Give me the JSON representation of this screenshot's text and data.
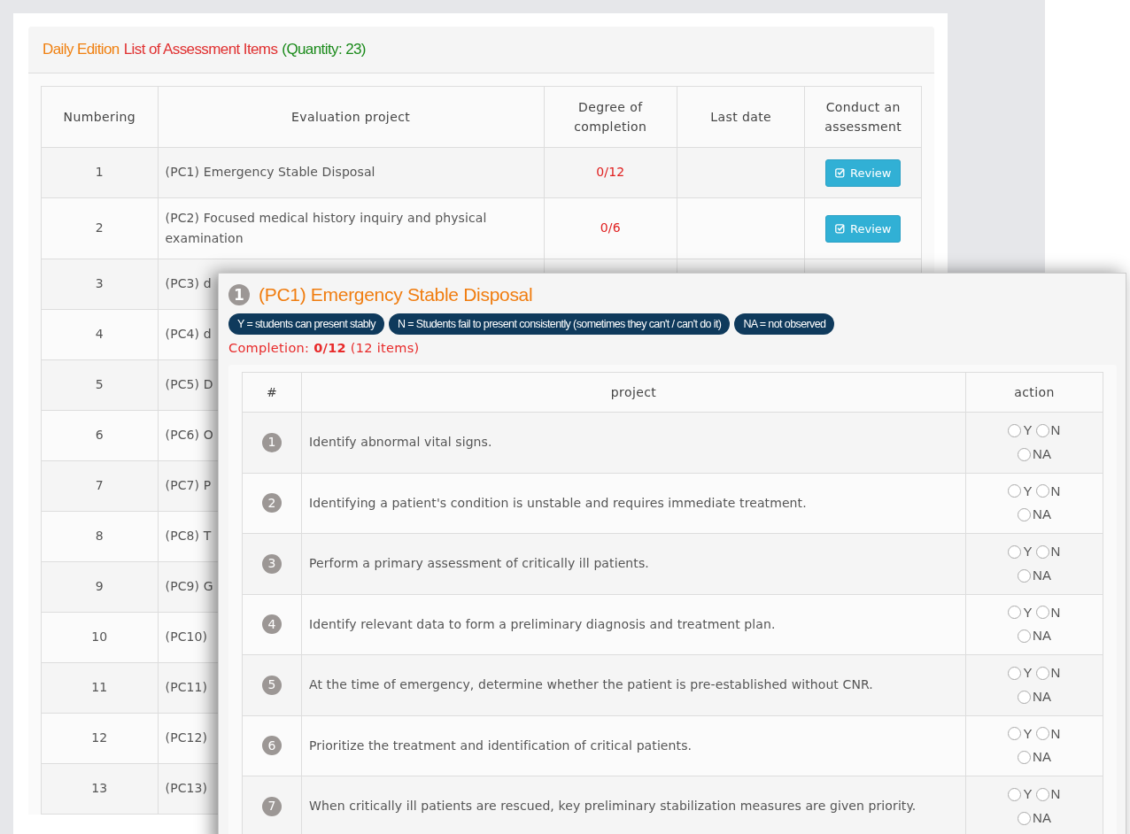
{
  "list_panel": {
    "title_parts": [
      {
        "text": "Daily Edition",
        "color": "#f08010"
      },
      {
        "text": "List of Assessment Items",
        "color": "#e03030"
      },
      {
        "text": "(Quantity: 23)",
        "color": "#1a8a1a"
      }
    ],
    "columns": [
      "Numbering",
      "Evaluation project",
      "Degree of completion",
      "Last date",
      "Conduct an assessment"
    ],
    "rows": [
      {
        "number": "1",
        "project": "(PC1) Emergency Stable Disposal",
        "completion": "0/12",
        "last_date": "",
        "button": "Review"
      },
      {
        "number": "2",
        "project": "(PC2) Focused medical history inquiry and physical examination",
        "completion": "0/6",
        "last_date": "",
        "button": "Review"
      },
      {
        "number": "3",
        "project": "(PC3) d"
      },
      {
        "number": "4",
        "project": "(PC4) d"
      },
      {
        "number": "5",
        "project": "(PC5) D"
      },
      {
        "number": "6",
        "project": "(PC6) O"
      },
      {
        "number": "7",
        "project": "(PC7) P"
      },
      {
        "number": "8",
        "project": "(PC8) T"
      },
      {
        "number": "9",
        "project": "(PC9) G"
      },
      {
        "number": "10",
        "project": "(PC10)"
      },
      {
        "number": "11",
        "project": "(PC11)"
      },
      {
        "number": "12",
        "project": "(PC12)"
      },
      {
        "number": "13",
        "project": "(PC13)"
      }
    ]
  },
  "detail_panel": {
    "number": "1",
    "title": "(PC1) Emergency Stable Disposal",
    "legend": [
      "Y = students can present stably",
      "N = Students fail to present consistently (sometimes they can't / can't do it)",
      "NA = not observed"
    ],
    "completion": "Completion: **0/12** (12 items)",
    "columns": [
      "#",
      "project",
      "action"
    ],
    "items": [
      {
        "number": "1",
        "text": "Identify abnormal vital signs.",
        "options": [
          {
            "label": "Y",
            "selected": false
          },
          {
            "label": "N",
            "selected": false
          },
          {
            "label": "NA",
            "selected": false
          }
        ]
      },
      {
        "number": "2",
        "text": "Identifying a patient's condition is unstable and requires immediate treatment.",
        "options": [
          {
            "label": "Y",
            "selected": false
          },
          {
            "label": "N",
            "selected": false
          },
          {
            "label": "NA",
            "selected": false
          }
        ]
      },
      {
        "number": "3",
        "text": "Perform a primary assessment of critically ill patients.",
        "options": [
          {
            "label": "Y",
            "selected": false
          },
          {
            "label": "N",
            "selected": false
          },
          {
            "label": "NA",
            "selected": false
          }
        ]
      },
      {
        "number": "4",
        "text": "Identify relevant data to form a preliminary diagnosis and treatment plan.",
        "options": [
          {
            "label": "Y",
            "selected": false
          },
          {
            "label": "N",
            "selected": false
          },
          {
            "label": "NA",
            "selected": false
          }
        ]
      },
      {
        "number": "5",
        "text": "At the time of emergency, determine whether the patient is pre-established without CNR.",
        "options": [
          {
            "label": "Y",
            "selected": false
          },
          {
            "label": "N",
            "selected": false
          },
          {
            "label": "NA",
            "selected": false
          }
        ]
      },
      {
        "number": "6",
        "text": "Prioritize the treatment and identification of critical patients.",
        "options": [
          {
            "label": "Y",
            "selected": false
          },
          {
            "label": "N",
            "selected": false
          },
          {
            "label": "NA",
            "selected": false
          }
        ]
      },
      {
        "number": "7",
        "text": "When critically ill patients are rescued, key preliminary stabilization measures are given priority.",
        "options": [
          {
            "label": "Y",
            "selected": false
          },
          {
            "label": "N",
            "selected": false
          },
          {
            "label": "NA",
            "selected": false
          }
        ]
      }
    ]
  }
}
